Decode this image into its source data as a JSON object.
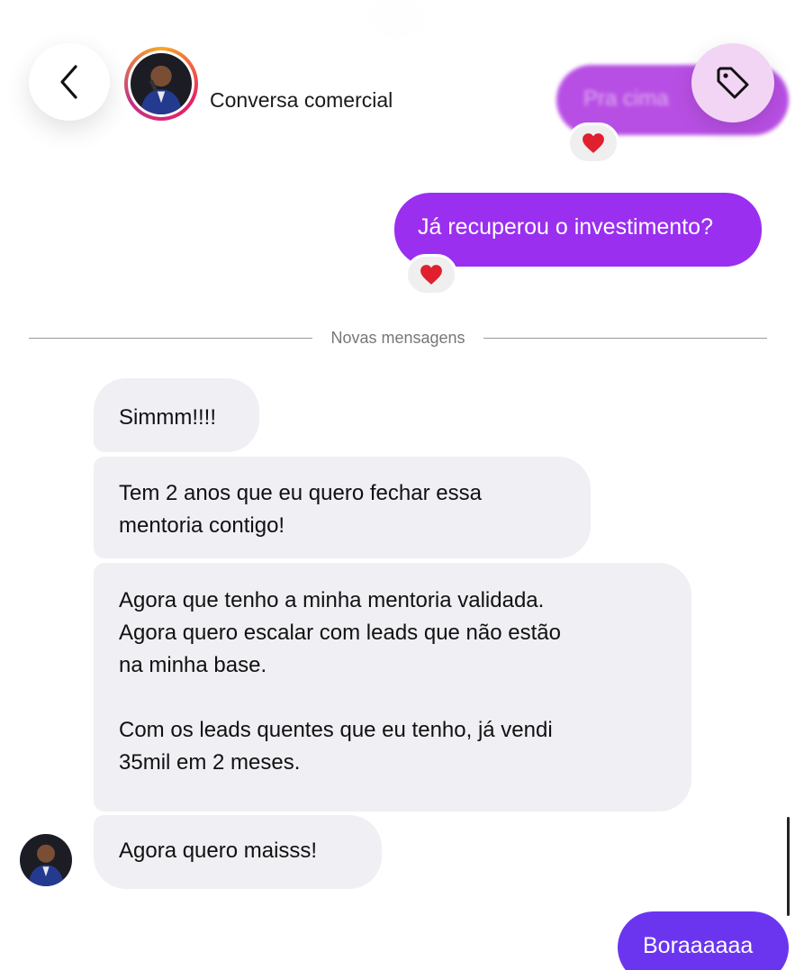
{
  "header": {
    "title": "Conversa comercial"
  },
  "messages": {
    "outgoing_partial": "Pra cima",
    "outgoing_1": "Já recuperou o investimento?",
    "divider_label": "Novas mensagens",
    "incoming_1": "Simmm!!!!",
    "incoming_2": [
      "Tem 2 anos que eu quero fechar essa",
      "mentoria contigo!"
    ],
    "incoming_3_para1": [
      "Agora que tenho a minha mentoria validada.",
      "Agora quero escalar com leads que não estão",
      "na minha base."
    ],
    "incoming_3_para2": [
      "Com os leads quentes que eu tenho, já vendi",
      "35mil em 2 meses."
    ],
    "incoming_4": "Agora quero maisss!",
    "outgoing_2": "Boraaaaaa"
  },
  "icons": {
    "back": "chevron-left-icon",
    "tag": "tag-icon",
    "reaction": "heart-icon"
  },
  "colors": {
    "outgoing_bubble": "#9a2ff0",
    "outgoing_bubble_latest": "#6b35f0",
    "incoming_bubble": "#efeff4",
    "tag_button": "#f2d4f4",
    "heart": "#e0202e"
  }
}
